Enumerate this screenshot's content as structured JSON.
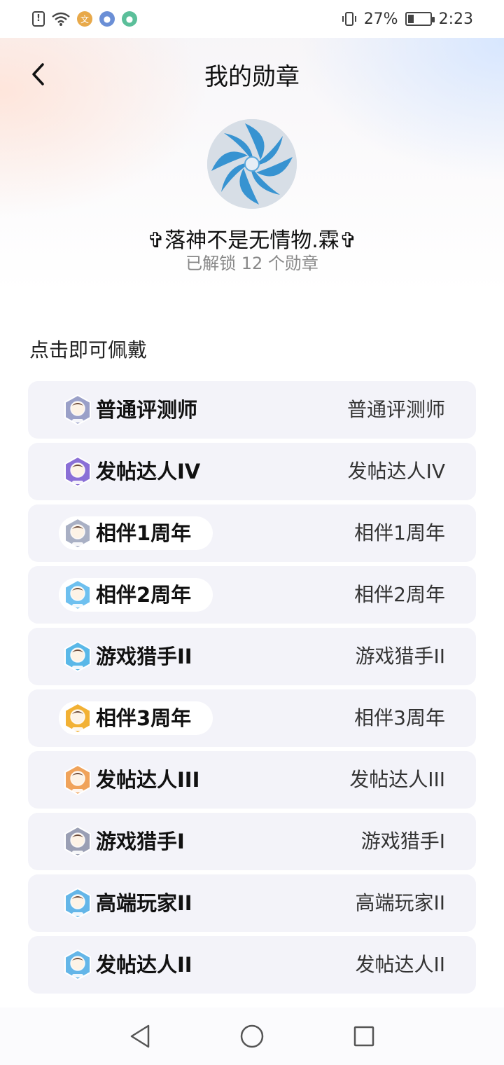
{
  "status_bar": {
    "battery": "27%",
    "time": "2:23",
    "battery_level": 0.27
  },
  "header": {
    "title": "我的勋章"
  },
  "profile": {
    "username": "✞落神不是无情物.霖✞",
    "unlock_text": "已解锁 12 个勋章"
  },
  "section": {
    "title": "点击即可佩戴"
  },
  "badges": [
    {
      "name": "普通评测师",
      "label": "普通评测师",
      "icon": "reviewer-badge-icon",
      "color": "#9aa0c8",
      "pill": false
    },
    {
      "name": "发帖达人IV",
      "label": "发帖达人IV",
      "icon": "poster-badge-icon",
      "color": "#8a6fd6",
      "pill": false
    },
    {
      "name": "相伴1周年",
      "label": "相伴1周年",
      "icon": "anniversary-1-badge-icon",
      "color": "#a9b0c4",
      "pill": true
    },
    {
      "name": "相伴2周年",
      "label": "相伴2周年",
      "icon": "anniversary-2-badge-icon",
      "color": "#6ec0ef",
      "pill": true
    },
    {
      "name": "游戏猎手II",
      "label": "游戏猎手II",
      "icon": "game-hunter-badge-icon",
      "color": "#5ab8e8",
      "pill": false
    },
    {
      "name": "相伴3周年",
      "label": "相伴3周年",
      "icon": "anniversary-3-badge-icon",
      "color": "#f2b134",
      "pill": true
    },
    {
      "name": "发帖达人III",
      "label": "发帖达人III",
      "icon": "poster-badge-icon",
      "color": "#f0a35a",
      "pill": false
    },
    {
      "name": "游戏猎手I",
      "label": "游戏猎手I",
      "icon": "game-hunter-badge-icon",
      "color": "#9a9fb4",
      "pill": false
    },
    {
      "name": "高端玩家II",
      "label": "高端玩家II",
      "icon": "player-badge-icon",
      "color": "#64b6e8",
      "pill": false
    },
    {
      "name": "发帖达人II",
      "label": "发帖达人II",
      "icon": "poster-badge-icon",
      "color": "#64b6e8",
      "pill": false
    }
  ]
}
